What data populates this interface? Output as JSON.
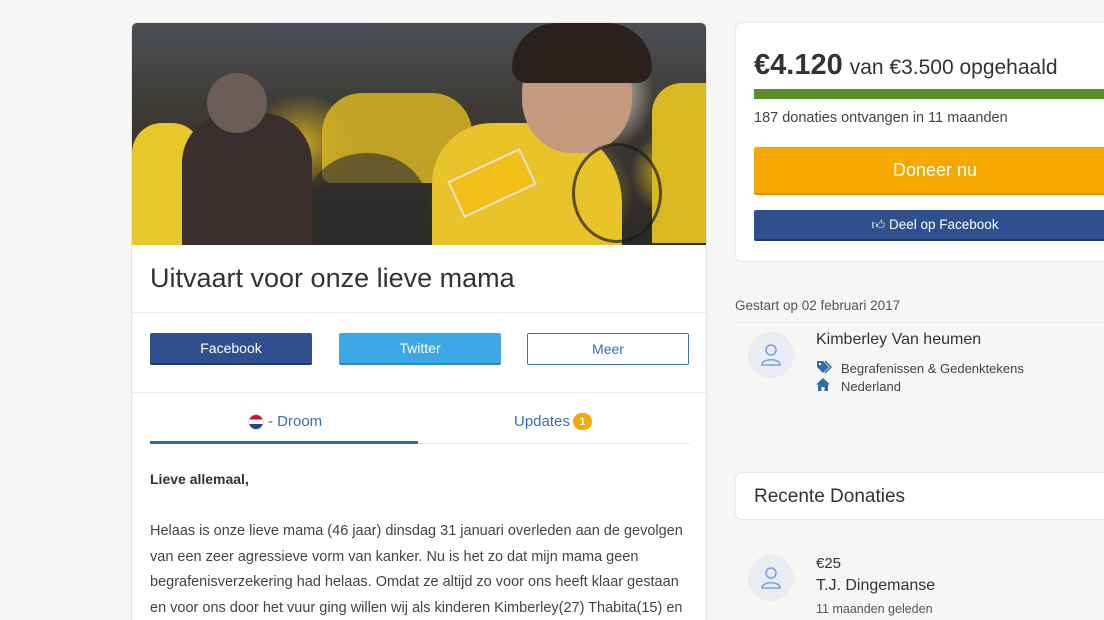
{
  "campaign": {
    "title": "Uitvaart voor onze lieve mama",
    "share": {
      "facebook": "Facebook",
      "twitter": "Twitter",
      "more": "Meer"
    },
    "tabs": {
      "story": "- Droom",
      "updates": "Updates",
      "updates_count": "1"
    },
    "story": {
      "heading": "Lieve allemaal,",
      "body": "Helaas is onze lieve mama (46 jaar) dinsdag 31 januari overleden aan de gevolgen van een zeer agressieve vorm van kanker. Nu is het zo dat mijn mama geen begrafenisverzekering had helaas. Omdat ze altijd zo voor ons heeft klaar gestaan en voor ons door het vuur ging willen wij als kinderen Kimberley(27) Thabita(15) en"
    }
  },
  "donation_box": {
    "raised": "€4.120",
    "raised_suffix": "van €3.500 opgehaald",
    "progress": 1.0,
    "progress_color": "#5a8f29",
    "count_text": "187 donaties ontvangen in 11 maanden",
    "donate_label": "Doneer nu",
    "fb_share_label": "Deel op Facebook"
  },
  "organizer": {
    "started": "Gestart op 02 februari 2017",
    "name": "Kimberley Van heumen",
    "category": "Begrafenissen & Gedenktekens",
    "location": "Nederland",
    "icons": {
      "category": "tags-icon",
      "location": "home-icon",
      "avatar": "user-icon"
    }
  },
  "recent": {
    "title": "Recente Donaties",
    "items": [
      {
        "amount": "€25",
        "name": "T.J. Dingemanse",
        "time": "11 maanden geleden"
      }
    ]
  },
  "colors": {
    "accent": "#2e6da8",
    "donate": "#f5a800",
    "facebook": "#2f4f8f",
    "twitter": "#3ea8e6"
  }
}
